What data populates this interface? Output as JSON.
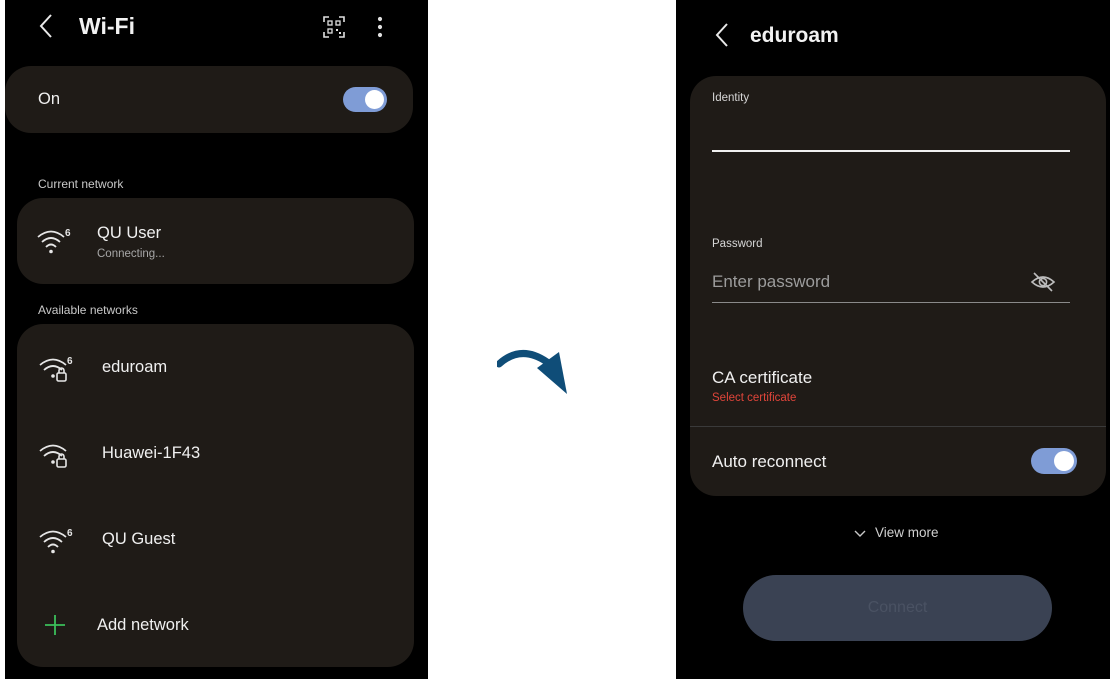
{
  "left_screen": {
    "header": {
      "title": "Wi-Fi"
    },
    "wifi_toggle": {
      "label": "On",
      "state": "on"
    },
    "current_network": {
      "section_label": "Current network",
      "name": "QU User",
      "status": "Connecting...",
      "wifi_badge": "6"
    },
    "available_networks": {
      "section_label": "Available networks",
      "items": [
        {
          "name": "eduroam",
          "wifi_badge": "6",
          "locked": true
        },
        {
          "name": "Huawei-1F43",
          "wifi_badge": "",
          "locked": true
        },
        {
          "name": "QU Guest",
          "wifi_badge": "6",
          "locked": false
        }
      ],
      "add_network_label": "Add network"
    }
  },
  "right_screen": {
    "header": {
      "title": "eduroam"
    },
    "identity": {
      "label": "Identity",
      "value": ""
    },
    "password": {
      "label": "Password",
      "placeholder": "Enter password"
    },
    "ca_certificate": {
      "label": "CA certificate",
      "hint": "Select certificate"
    },
    "auto_reconnect": {
      "label": "Auto reconnect",
      "state": "on"
    },
    "view_more_label": "View more",
    "connect_label": "Connect"
  },
  "colors": {
    "card_bg": "#1f1b17",
    "toggle_on": "#7f9cd6",
    "add_icon": "#3bbf5a",
    "error_text": "#e0453a",
    "arrow": "#0f4d78",
    "connect_disabled": "#3a4253"
  }
}
